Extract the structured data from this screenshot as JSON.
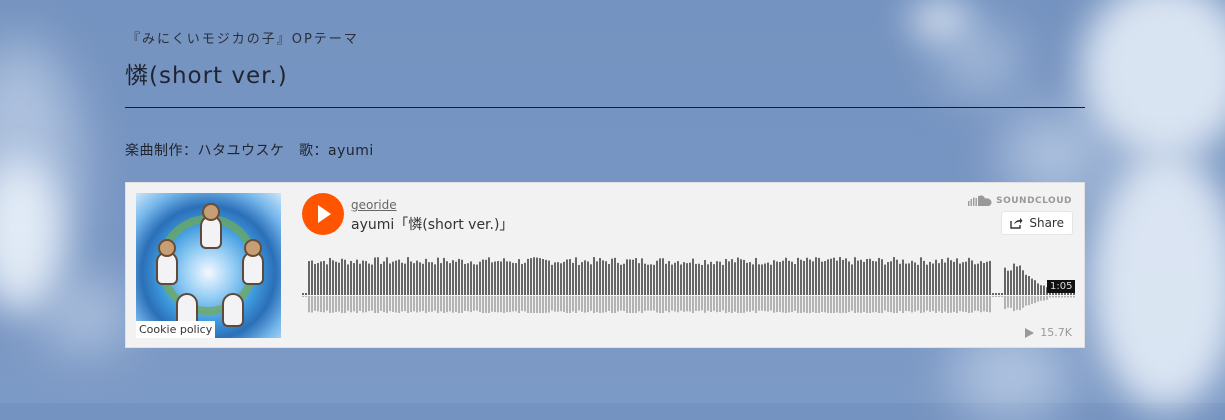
{
  "page": {
    "subtitle": "『みにくいモジカの子』OPテーマ",
    "title": "憐(short ver.)",
    "credits": "楽曲制作：ハタユウスケ　歌：ayumi"
  },
  "player": {
    "uploader": "georide",
    "track_title": "ayumi「憐(short ver.)」",
    "brand": "SOUNDCLOUD",
    "share_label": "Share",
    "duration": "1:05",
    "play_count": "15.7K",
    "cookie_policy": "Cookie policy",
    "accent_color": "#ff5500",
    "icons": [
      "play-icon",
      "soundcloud-logo-icon",
      "share-icon",
      "play-count-icon"
    ]
  }
}
